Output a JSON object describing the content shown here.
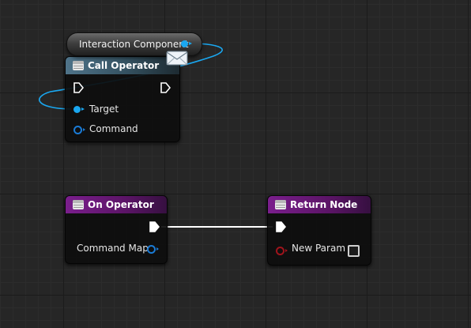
{
  "variable_node": {
    "label": "Interaction Component"
  },
  "call_operator": {
    "title": "Call Operator",
    "pins": {
      "target": "Target",
      "command": "Command"
    }
  },
  "on_operator": {
    "title": "On Operator",
    "pins": {
      "command_map": "Command Map"
    }
  },
  "return_node": {
    "title": "Return Node",
    "pins": {
      "new_param": "New Param"
    }
  },
  "colors": {
    "object_pin": "#1aa7f0",
    "exec_pin": "#ffffff",
    "bool_pin": "#a0141c",
    "function_header": "#4f7389",
    "event_header": "#7a1e8c"
  },
  "icons": [
    "function-icon",
    "exec-pin-icon",
    "object-pin-icon",
    "envelope-icon",
    "checkbox-icon"
  ]
}
